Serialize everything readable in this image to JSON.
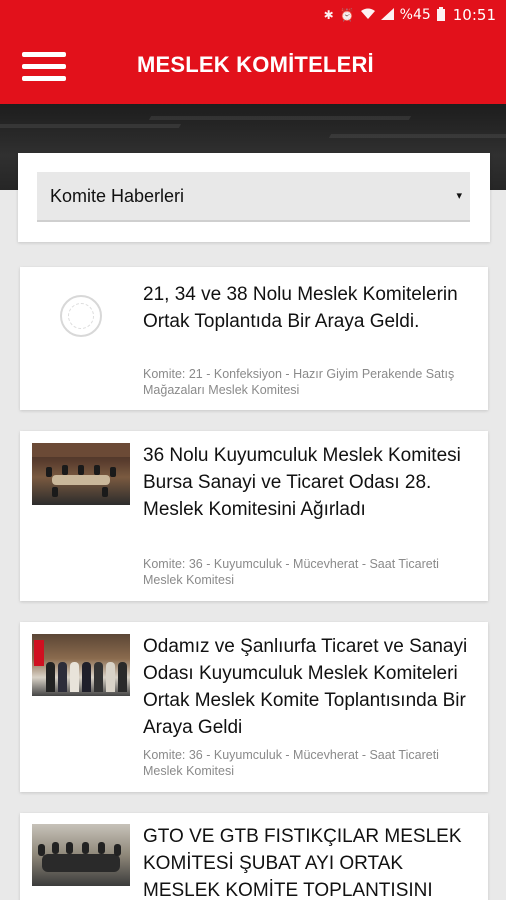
{
  "status_bar": {
    "icons": [
      "bluetooth-icon",
      "alarm-icon",
      "wifi-icon",
      "signal-icon"
    ],
    "battery": "%45",
    "time": "10:51"
  },
  "app_bar": {
    "title": "MESLEK KOMİTELERİ",
    "menu_icon": "hamburger-menu-icon"
  },
  "filter": {
    "selected": "Komite Haberleri",
    "arrow": "▾"
  },
  "news": [
    {
      "title": "21, 34 ve 38 Nolu Meslek Komitelerin Ortak Toplantıda Bir Araya Geldi.",
      "meta": "Komite: 21 - Konfeksiyon - Hazır Giyim Perakende Satış Mağazaları Meslek Komitesi"
    },
    {
      "title": "36 Nolu Kuyumculuk Meslek Komitesi Bursa Sanayi ve Ticaret Odası 28. Meslek Komitesini Ağırladı",
      "meta": "Komite: 36 - Kuyumculuk - Mücevherat - Saat Ticareti Meslek Komitesi"
    },
    {
      "title": "Odamız ve Şanlıurfa Ticaret ve Sanayi Odası Kuyumculuk Meslek Komiteleri Ortak Meslek Komite Toplantısında Bir Araya Geldi",
      "meta": "Komite: 36 - Kuyumculuk - Mücevherat - Saat Ticareti Meslek Komitesi"
    },
    {
      "title": "GTO VE GTB FISTIKÇILAR MESLEK KOMİTESİ ŞUBAT AYI ORTAK MESLEK KOMİTE TOPLANTISINI",
      "meta": ""
    }
  ]
}
